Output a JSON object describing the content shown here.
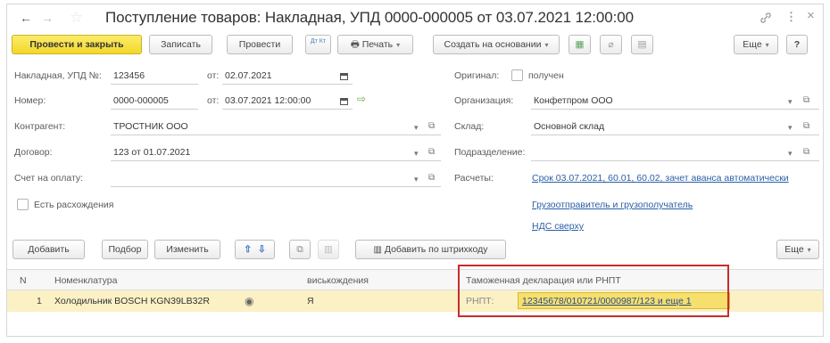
{
  "window": {
    "title": "Поступление товаров: Накладная, УПД 0000-000005 от 03.07.2021 12:00:00",
    "back_icon": "←",
    "forward_icon": "→",
    "link_icon": "🔗",
    "more_icon": "⋮",
    "close_icon": "×"
  },
  "toolbar": {
    "post_close": "Провести и закрыть",
    "save": "Записать",
    "post": "Провести",
    "dtkt": "Дт Кт",
    "print": "Печать",
    "create_based": "Создать на основании",
    "more": "Еще",
    "help": "?"
  },
  "form": {
    "invoice_label": "Накладная, УПД №:",
    "invoice_no": "123456",
    "from1_label": "от:",
    "invoice_date": "02.07.2021",
    "original_label": "Оригинал:",
    "received": "получен",
    "number_label": "Номер:",
    "number": "0000-000005",
    "from2_label": "от:",
    "doc_date": "03.07.2021 12:00:00",
    "org_label": "Организация:",
    "org": "Конфетпром ООО",
    "contractor_label": "Контрагент:",
    "contractor": "ТРОСТНИК ООО",
    "warehouse_label": "Склад:",
    "warehouse": "Основной склад",
    "contract_label": "Договор:",
    "contract": "123 от 01.07.2021",
    "division_label": "Подразделение:",
    "division": "",
    "pay_invoice_label": "Счет на оплату:",
    "pay_invoice": "",
    "settlements_label": "Расчеты:",
    "settlements_link": "Срок 03.07.2021, 60.01, 60.02, зачет аванса автоматически",
    "shipper_link": "Грузоотправитель и грузополучатель",
    "vat_link": "НДС сверху",
    "discrepancy_label": "Есть расхождения"
  },
  "table_toolbar": {
    "add": "Добавить",
    "pick": "Подбор",
    "change": "Изменить",
    "add_barcode": "Добавить по штрихкоду",
    "more": "Еще"
  },
  "table": {
    "headers": {
      "n": "N",
      "item": "Номенклатура",
      "discrepancy": "виськождения",
      "customs": "Таможенная декларация или РНПТ"
    },
    "rows": [
      {
        "n": "1",
        "item": "Холодильник BOSCH KGN39LB32R",
        "discrepancy": "Я",
        "rnpt_label": "РНПТ:",
        "rnpt": "12345678/010721/0000987/123 и еще 1"
      }
    ]
  }
}
